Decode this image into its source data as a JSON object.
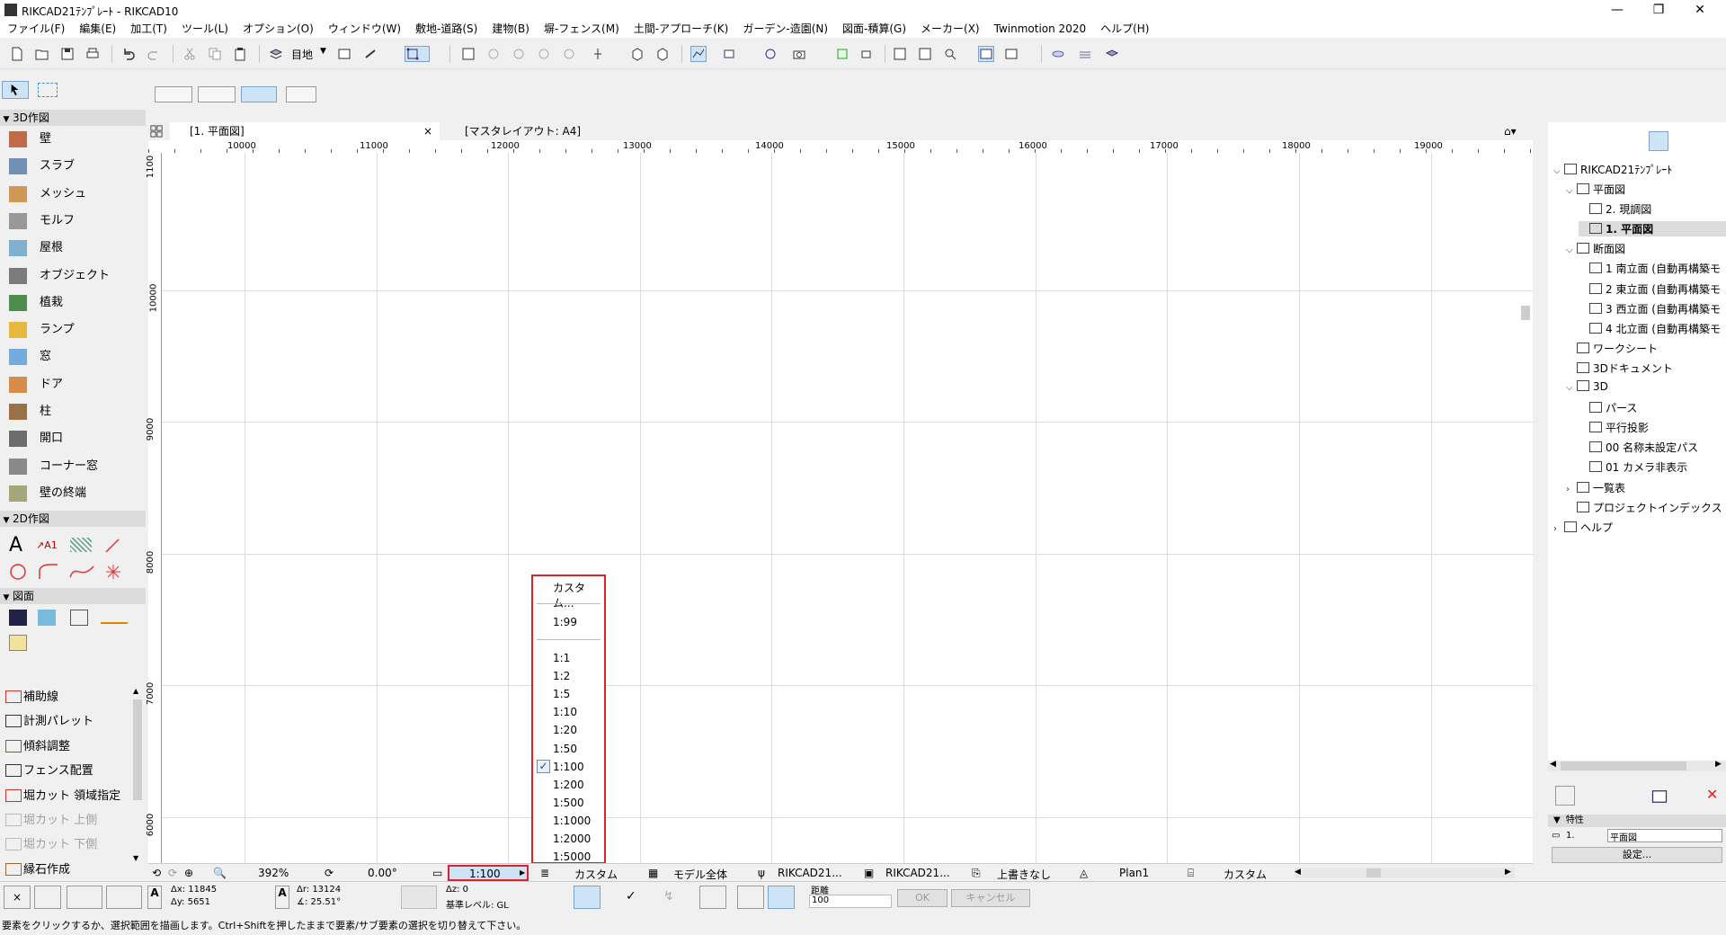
{
  "window": {
    "title": "RIKCAD21ﾃﾝﾌﾟﾚｰﾄ - RIKCAD10",
    "min": "—",
    "max": "❐",
    "close": "✕"
  },
  "menu": [
    "ファイル(F)",
    "編集(E)",
    "加工(T)",
    "ツール(L)",
    "オプション(O)",
    "ウィンドウ(W)",
    "敷地-道路(S)",
    "建物(B)",
    "塀-フェンス(M)",
    "土間-アプローチ(K)",
    "ガーデン-造園(N)",
    "図面-積算(G)",
    "メーカー(X)",
    "Twinmotion 2020",
    "ヘルプ(H)"
  ],
  "toolbar": {
    "layer_label": "目地"
  },
  "toolbox": {
    "group_3d": "3D作図",
    "tools_3d": [
      "壁",
      "スラブ",
      "メッシュ",
      "モルフ",
      "屋根",
      "オブジェクト",
      "植栽",
      "ランプ",
      "窓",
      "ドア",
      "柱",
      "開口",
      "コーナー窓",
      "壁の終端"
    ],
    "group_2d": "2D作図",
    "group_drawing": "図面",
    "tools_extra": [
      "補助線",
      "計測パレット",
      "傾斜調整",
      "フェンス配置",
      "堀カット 領域指定",
      "堀カット 上側",
      "堀カット 下側",
      "縁石作成"
    ]
  },
  "tabs": [
    {
      "label": "[1. 平面図]",
      "close": "×"
    },
    {
      "label": "[マスタレイアウト: A4]"
    }
  ],
  "ruler_h": [
    "10000",
    "11000",
    "12000",
    "13000",
    "14000",
    "15000",
    "16000",
    "17000",
    "18000",
    "19000"
  ],
  "ruler_v": [
    "1100",
    "10000",
    "9000",
    "8000",
    "7000",
    "6000"
  ],
  "scale_menu": {
    "custom": "カスタム...",
    "recent": "1:99",
    "options": [
      "1:1",
      "1:2",
      "1:5",
      "1:10",
      "1:20",
      "1:50",
      "1:100",
      "1:200",
      "1:500",
      "1:1000",
      "1:2000",
      "1:5000"
    ],
    "selected": "1:100",
    "check": "✓"
  },
  "statusbar": {
    "zoom": "392%",
    "angle": "0.00°",
    "scale": "1:100",
    "pen_set": "カスタム",
    "model_view": "モデル全体",
    "layer_combo": "RIKCAD21...",
    "dim_std": "RIKCAD21...",
    "override": "上書きなし",
    "renovation": "Plan1",
    "structure": "カスタム"
  },
  "coords": {
    "dx": "Δx: 11845",
    "dy": "Δy: 5651",
    "dr": "Δr: 13124",
    "da": "∡: 25.51°",
    "dz": "Δz: 0",
    "ref_level": "基準レベル: GL",
    "dist_label": "距離",
    "dist_value": "100",
    "ok": "OK",
    "cancel": "キャンセル"
  },
  "hint": "要素をクリックするか、選択範囲を描画します。Ctrl+Shiftを押したままで要素/サブ要素の選択を切り替えて下さい。",
  "navigator": {
    "root": "RIKCAD21ﾃﾝﾌﾟﾚｰﾄ",
    "items": [
      {
        "label": "平面図",
        "indent": 1,
        "exp": "down"
      },
      {
        "label": "2. 現調図",
        "indent": 2
      },
      {
        "label": "1. 平面図",
        "indent": 2,
        "selected": true
      },
      {
        "label": "断面図",
        "indent": 1,
        "exp": "down"
      },
      {
        "label": "1 南立面 (自動再構築モ",
        "indent": 2
      },
      {
        "label": "2 東立面 (自動再構築モ",
        "indent": 2
      },
      {
        "label": "3 西立面 (自動再構築モ",
        "indent": 2
      },
      {
        "label": "4 北立面 (自動再構築モ",
        "indent": 2
      },
      {
        "label": "ワークシート",
        "indent": 1
      },
      {
        "label": "3Dドキュメント",
        "indent": 1
      },
      {
        "label": "3D",
        "indent": 1,
        "exp": "down"
      },
      {
        "label": "パース",
        "indent": 2
      },
      {
        "label": "平行投影",
        "indent": 2
      },
      {
        "label": "00 名称未設定パス",
        "indent": 2
      },
      {
        "label": "01 カメラ非表示",
        "indent": 2
      },
      {
        "label": "一覧表",
        "indent": 1,
        "exp": "right"
      },
      {
        "label": "プロジェクトインデックス",
        "indent": 1
      },
      {
        "label": "ヘルプ",
        "indent": 0,
        "exp": "right"
      }
    ],
    "props_header": "特性",
    "props_id": "1.",
    "props_name": "平面図",
    "settings": "設定..."
  }
}
